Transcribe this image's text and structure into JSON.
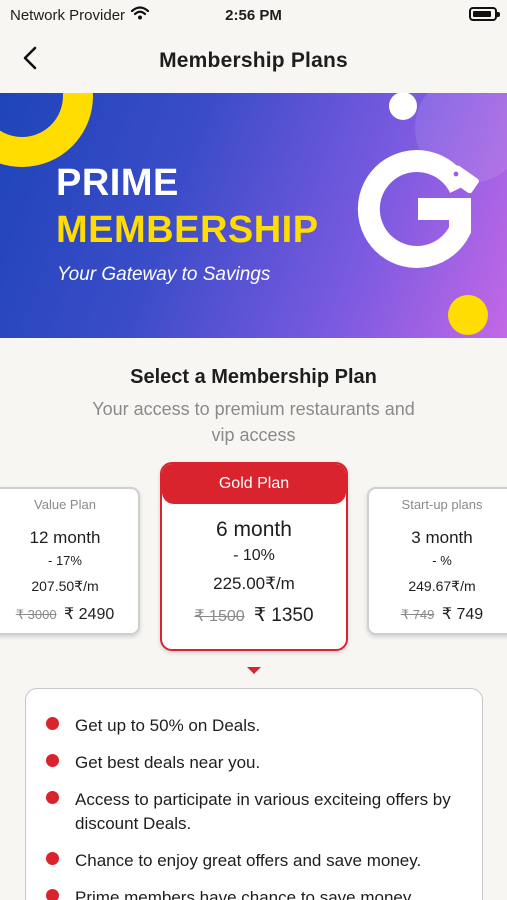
{
  "status": {
    "carrier": "Network Provider",
    "time": "2:56 PM",
    "battery_level": 0.9,
    "icons": [
      "wifi-icon",
      "battery-icon"
    ]
  },
  "nav": {
    "title": "Membership Plans",
    "back_icon": "chevron-left-icon"
  },
  "banner": {
    "line1": "PRIME",
    "line2": "MEMBERSHIP",
    "tagline": "Your Gateway to Savings",
    "logo_icon": "g-tag-logo-icon",
    "colors": {
      "gradient_start": "#1f44b9",
      "gradient_end": "#c268e6",
      "accent_yellow": "#ffdd00"
    }
  },
  "section": {
    "title": "Select a Membership Plan",
    "subtitle": "Your access to premium restaurants and vip access"
  },
  "plans": [
    {
      "name": "Value Plan",
      "duration": "12 month",
      "discount": "- 17%",
      "rate": "207.50₹/m",
      "original_price": "₹ 3000",
      "price": "₹ 2490"
    },
    {
      "name": "Gold Plan",
      "duration": "6 month",
      "discount": "- 10%",
      "rate": "225.00₹/m",
      "original_price": "₹ 1500",
      "price": "₹ 1350",
      "selected": true
    },
    {
      "name": "Start-up plans",
      "duration": "3 month",
      "discount": "- %",
      "rate": "249.67₹/m",
      "original_price": "₹ 749",
      "price": "₹ 749"
    }
  ],
  "features": [
    "Get up to 50% on Deals.",
    "Get best deals near you.",
    "Access to participate in various exciteing offers by discount Deals.",
    "Chance to enjoy great offers and save money.",
    "Prime members have chance to save money"
  ],
  "colors": {
    "primary_red": "#d9232d",
    "background": "#f7f6f3",
    "muted_text": "#8a8a8a"
  }
}
